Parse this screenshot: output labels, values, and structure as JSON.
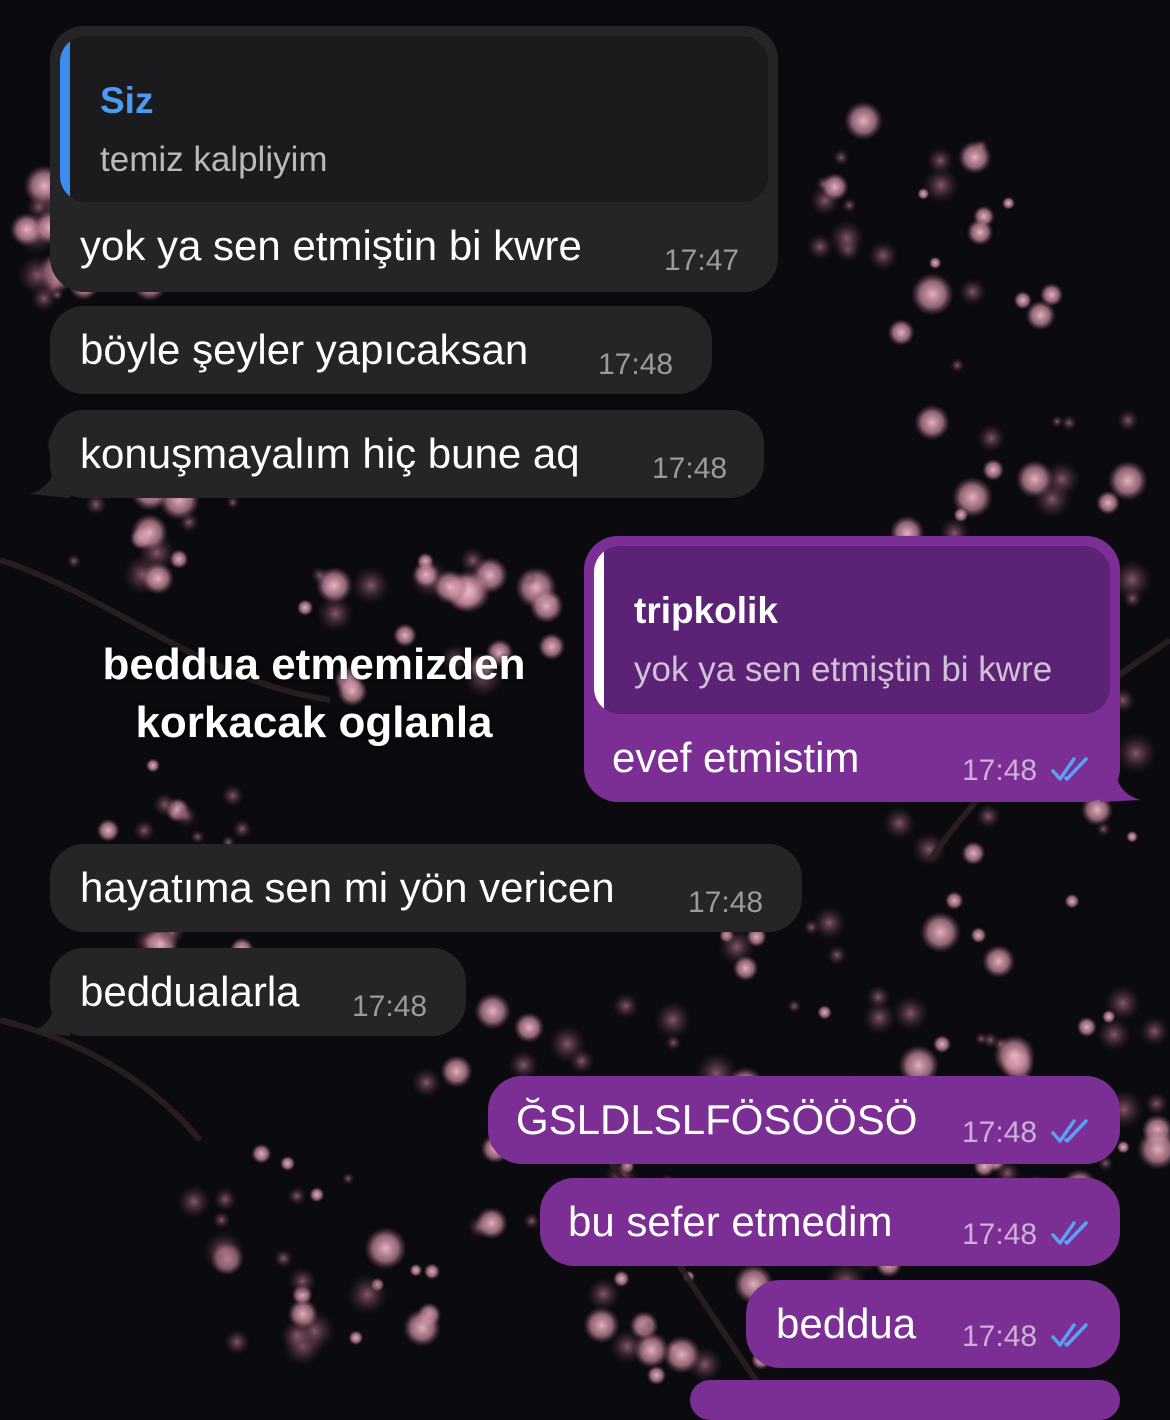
{
  "overlay_caption": {
    "line1": "beddua etmemizden",
    "line2": "korkacak oglanla"
  },
  "messages": [
    {
      "id": "m1",
      "direction": "incoming",
      "reply": {
        "name": "Siz",
        "text": "temiz kalpliyim"
      },
      "text": "yok ya sen etmiştin bi kwre",
      "time": "17:47"
    },
    {
      "id": "m2",
      "direction": "incoming",
      "text": "böyle şeyler yapıcaksan",
      "time": "17:48"
    },
    {
      "id": "m3",
      "direction": "incoming",
      "text": "konuşmayalım hiç bune aq",
      "time": "17:48"
    },
    {
      "id": "m4",
      "direction": "outgoing",
      "reply": {
        "name": "tripkolik",
        "text": "yok ya sen etmiştin bi kwre"
      },
      "text": "evef etmistim",
      "time": "17:48",
      "status": "read"
    },
    {
      "id": "m5",
      "direction": "incoming",
      "text": "hayatıma sen mi yön vericen",
      "time": "17:48"
    },
    {
      "id": "m6",
      "direction": "incoming",
      "text": "beddualarla",
      "time": "17:48"
    },
    {
      "id": "m7",
      "direction": "outgoing",
      "text": "ĞSLDLSLFÖSÖÖSÖ",
      "time": "17:48",
      "status": "read"
    },
    {
      "id": "m8",
      "direction": "outgoing",
      "text": "bu sefer etmedim",
      "time": "17:48",
      "status": "read"
    },
    {
      "id": "m9",
      "direction": "outgoing",
      "text": "beddua",
      "time": "17:48",
      "status": "read"
    }
  ],
  "colors": {
    "incoming_bubble": "#252527",
    "outgoing_bubble": "#7b2f94",
    "reply_accent_incoming": "#3d8df0",
    "read_ticks": "#5aa0f5",
    "background": "#0b0a0f"
  },
  "icons": {
    "read_status": "double-check-icon",
    "background": "cherry-blossom-wallpaper"
  }
}
